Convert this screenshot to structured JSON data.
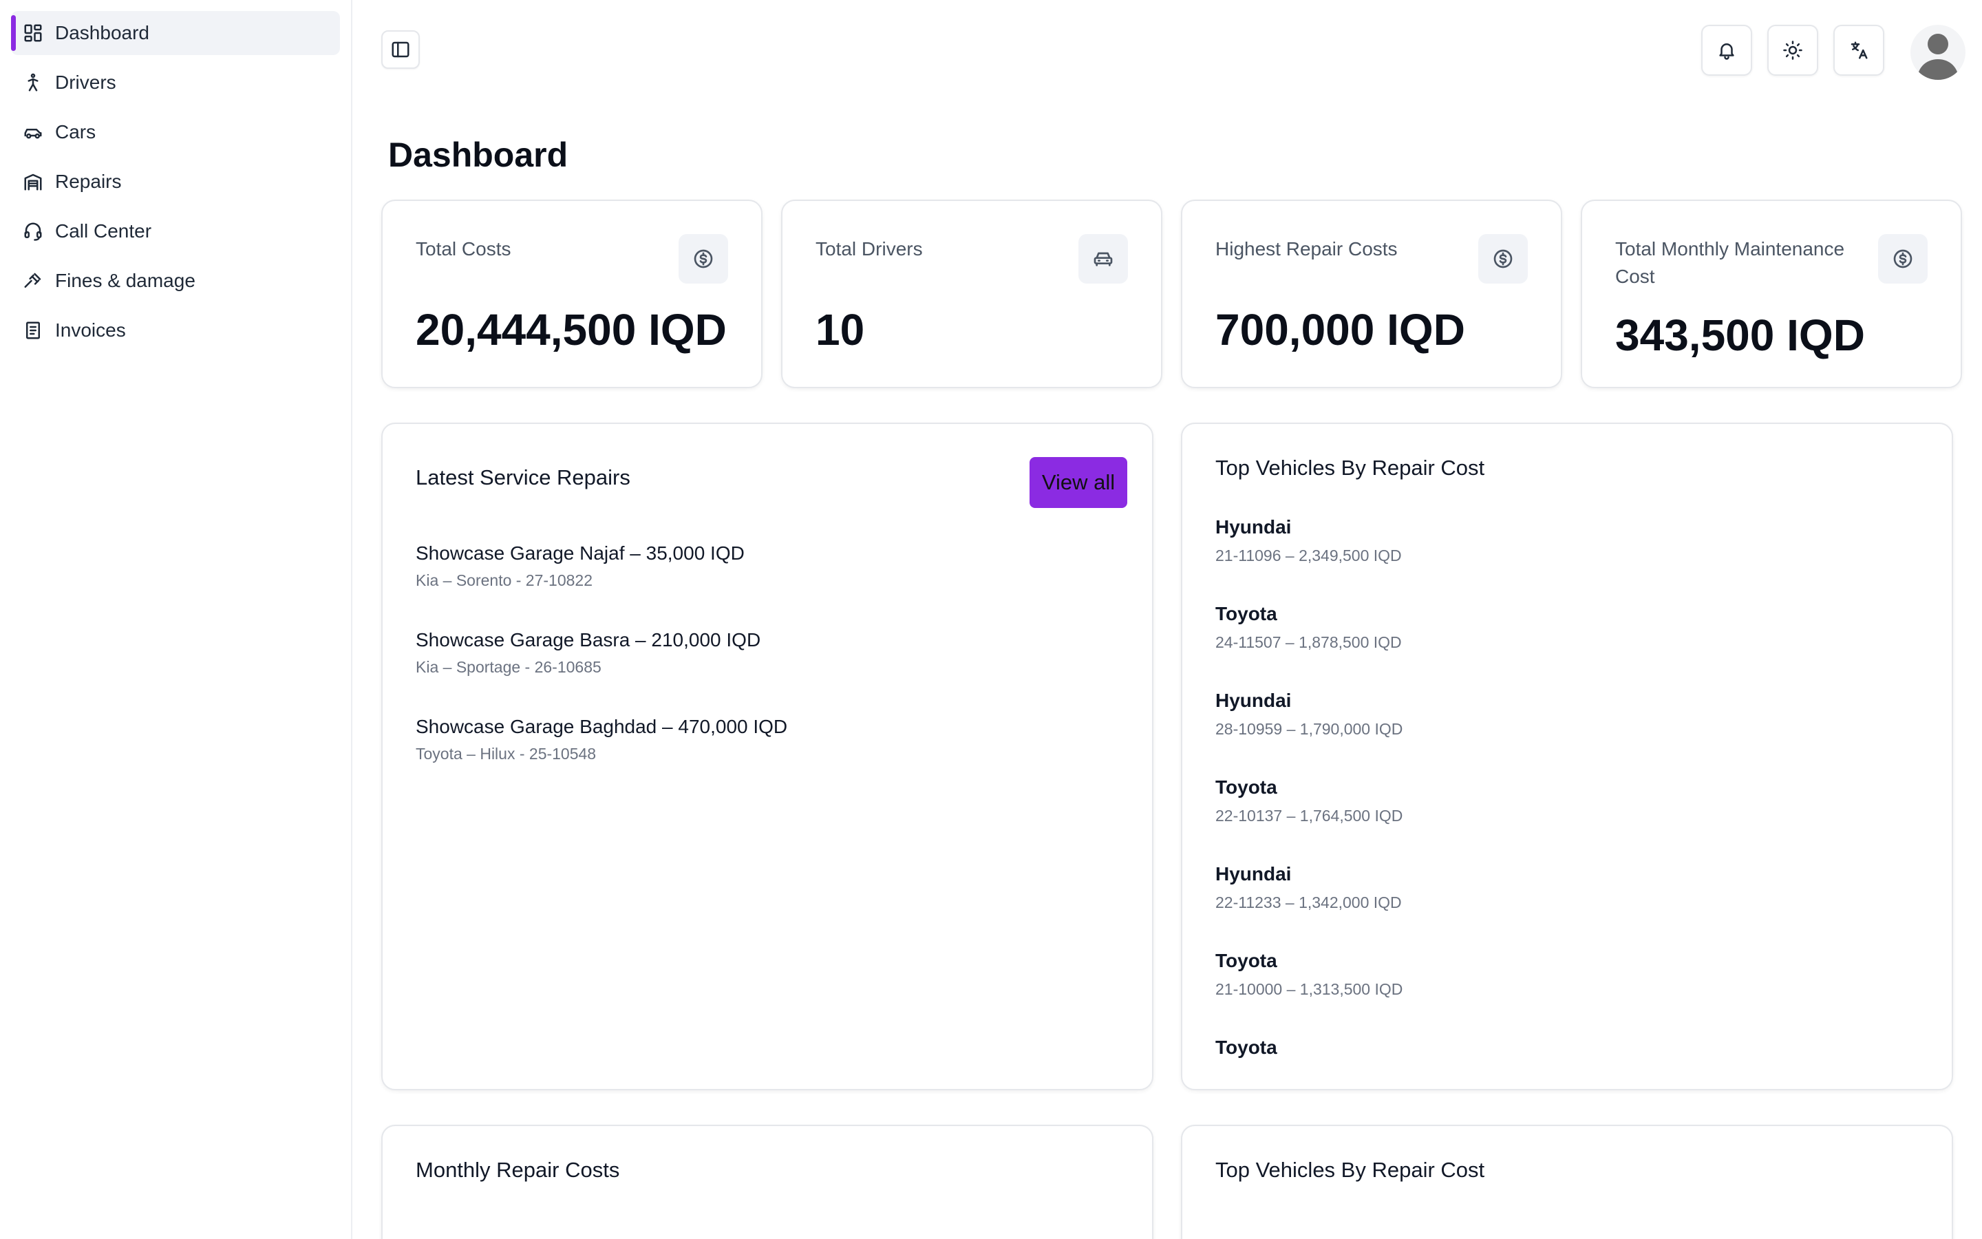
{
  "sidebar": {
    "items": [
      {
        "label": "Dashboard",
        "icon": "dashboard-grid-icon",
        "active": true
      },
      {
        "label": "Drivers",
        "icon": "person-walking-icon"
      },
      {
        "label": "Cars",
        "icon": "car-icon"
      },
      {
        "label": "Repairs",
        "icon": "garage-icon"
      },
      {
        "label": "Call Center",
        "icon": "headset-icon"
      },
      {
        "label": "Fines & damage",
        "icon": "gavel-icon"
      },
      {
        "label": "Invoices",
        "icon": "receipt-icon"
      }
    ]
  },
  "topbar": {
    "toggle_icon": "sidebar-toggle-icon",
    "buttons": [
      "bell-icon",
      "sun-icon",
      "translate-icon"
    ],
    "avatar_icon": "user-avatar-icon"
  },
  "page": {
    "title": "Dashboard"
  },
  "stats": [
    {
      "label": "Total Costs",
      "value": "20,444,500 IQD",
      "icon": "dollar-circle-icon"
    },
    {
      "label": "Total Drivers",
      "value": "10",
      "icon": "car-front-icon"
    },
    {
      "label": "Highest Repair Costs",
      "value": "700,000 IQD",
      "icon": "dollar-circle-icon"
    },
    {
      "label": "Total Monthly Maintenance Cost",
      "value": "343,500 IQD",
      "icon": "dollar-circle-icon"
    }
  ],
  "latest_repairs": {
    "title": "Latest Service Repairs",
    "view_all_label": "View all",
    "items": [
      {
        "main": "Showcase Garage Najaf – 35,000 IQD",
        "sub": "Kia – Sorento - 27-10822"
      },
      {
        "main": "Showcase Garage Basra – 210,000 IQD",
        "sub": "Kia – Sportage - 26-10685"
      },
      {
        "main": "Showcase Garage Baghdad – 470,000 IQD",
        "sub": "Toyota – Hilux - 25-10548"
      }
    ]
  },
  "top_vehicles": {
    "title": "Top Vehicles By Repair Cost",
    "items": [
      {
        "main": "Hyundai",
        "sub": "21-11096 – 2,349,500 IQD"
      },
      {
        "main": "Toyota",
        "sub": "24-11507 – 1,878,500 IQD"
      },
      {
        "main": "Hyundai",
        "sub": "28-10959 – 1,790,000 IQD"
      },
      {
        "main": "Toyota",
        "sub": "22-10137 – 1,764,500 IQD"
      },
      {
        "main": "Hyundai",
        "sub": "22-11233 – 1,342,000 IQD"
      },
      {
        "main": "Toyota",
        "sub": "21-10000 – 1,313,500 IQD"
      },
      {
        "main": "Toyota",
        "sub": ""
      }
    ]
  },
  "bottom": {
    "monthly_title": "Monthly Repair Costs",
    "top_vehicles_title": "Top Vehicles By Repair Cost"
  },
  "colors": {
    "accent": "#8b2be2",
    "border": "#e5e7eb",
    "icon_bg": "#f1f3f7"
  }
}
